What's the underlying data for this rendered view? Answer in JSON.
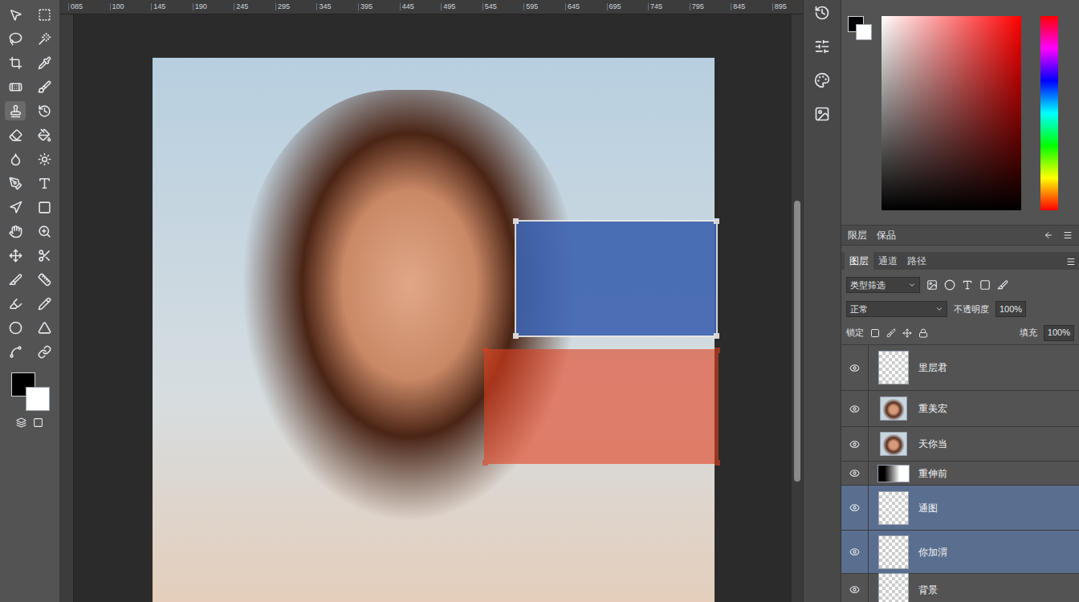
{
  "ruler": {
    "labels": [
      "085",
      "100",
      "145",
      "190",
      "245",
      "295",
      "345",
      "395",
      "445",
      "495",
      "545",
      "595",
      "645",
      "695",
      "745",
      "795",
      "845",
      "895"
    ]
  },
  "tools": [
    {
      "selected": false
    },
    {
      "selected": false
    },
    {
      "selected": false
    },
    {
      "selected": false
    },
    {
      "selected": false
    },
    {
      "selected": false
    },
    {
      "selected": false
    },
    {
      "selected": false
    },
    {
      "selected": true
    },
    {
      "selected": false
    },
    {
      "selected": false
    },
    {
      "selected": false
    },
    {
      "selected": false
    },
    {
      "selected": false
    },
    {
      "selected": false
    },
    {
      "selected": false
    },
    {
      "selected": false
    },
    {
      "selected": false
    },
    {
      "selected": false
    },
    {
      "selected": false
    },
    {
      "selected": false
    },
    {
      "selected": false
    },
    {
      "selected": false
    },
    {
      "selected": false
    },
    {
      "selected": false
    },
    {
      "selected": false
    },
    {
      "selected": false
    },
    {
      "selected": false
    },
    {
      "selected": false
    },
    {
      "selected": false
    }
  ],
  "selections": [
    {
      "color": "#3d63b0",
      "border": "#e8e8e8"
    },
    {
      "color": "#e2401f",
      "border": "#e2401f"
    }
  ],
  "color_panel": {
    "tabs": [
      "限层",
      "保品"
    ]
  },
  "layers_panel": {
    "tabs": [
      {
        "label": "图层",
        "selected": true
      },
      {
        "label": "通道",
        "selected": false
      },
      {
        "label": "路径",
        "selected": false
      }
    ],
    "filter": "类型筛选",
    "blend": "正常",
    "opacity_label": "不透明度",
    "opacity": "100%",
    "lock_label": "锁定",
    "fill_label": "填充",
    "fill": "100%",
    "layers": [
      {
        "name": "里层君",
        "kind": "transparent",
        "visible": true,
        "selected": false
      },
      {
        "name": "重美宏",
        "kind": "photo",
        "visible": true,
        "selected": false
      },
      {
        "name": "天你当",
        "kind": "photo",
        "visible": true,
        "selected": false
      },
      {
        "name": "重伸前",
        "kind": "mask",
        "visible": true,
        "selected": false
      },
      {
        "name": "通图",
        "kind": "transparent",
        "visible": true,
        "selected": true
      },
      {
        "name": "你加渭",
        "kind": "transparent",
        "visible": true,
        "selected": true
      },
      {
        "name": "背景",
        "kind": "transparent",
        "visible": true,
        "selected": false
      }
    ]
  }
}
